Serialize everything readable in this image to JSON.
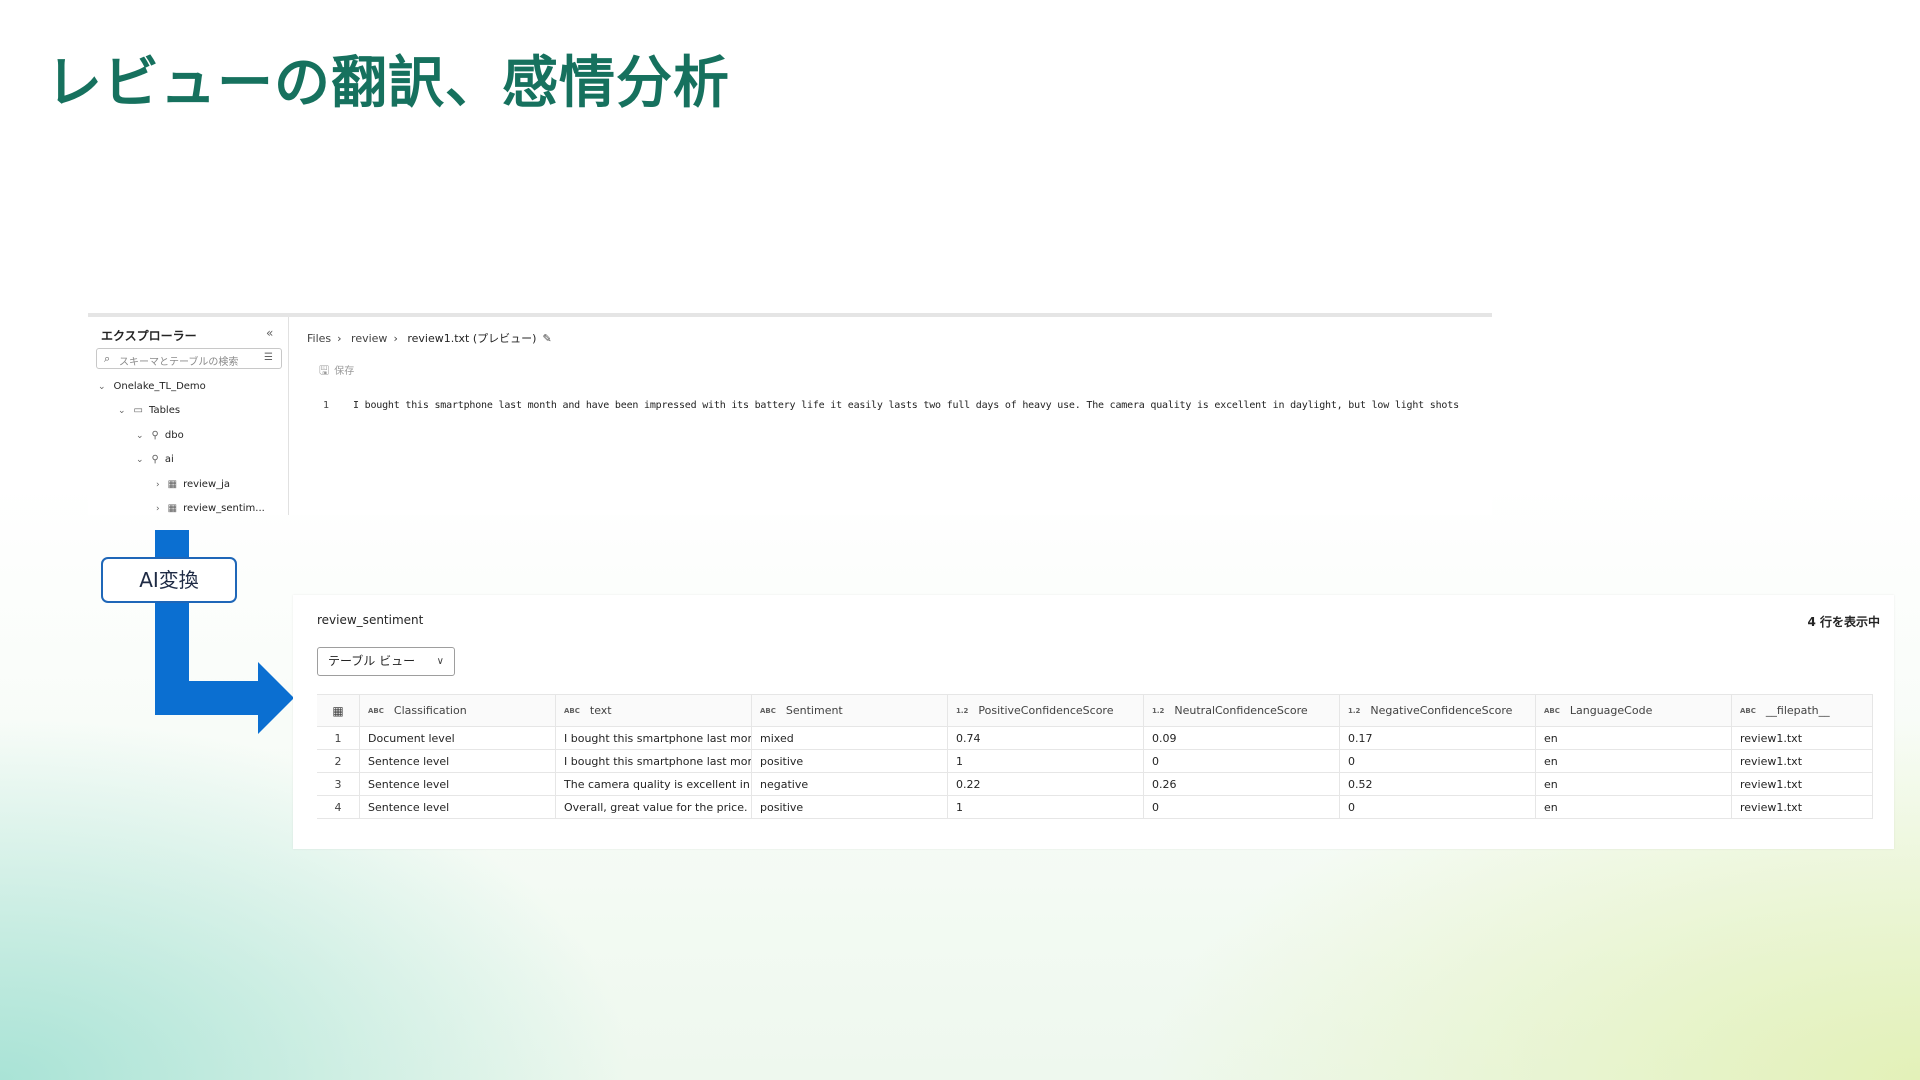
{
  "slide": {
    "title": "レビューの翻訳、感情分析"
  },
  "explorer": {
    "title": "エクスプローラー",
    "search_placeholder": "スキーマとテーブルの検索",
    "tree": [
      {
        "label": "Onelake_TL_Demo"
      },
      {
        "label": "Tables"
      },
      {
        "label": "dbo"
      },
      {
        "label": "ai"
      },
      {
        "label": "review_ja"
      },
      {
        "label": "review_sentim..."
      }
    ]
  },
  "viewer": {
    "breadcrumb": [
      "Files",
      "review",
      "review1.txt (プレビュー)"
    ],
    "save_label": "保存",
    "line_number": "1",
    "line_text": "I bought this smartphone last month and have been impressed with its battery life it easily lasts two full days of heavy use. The camera quality is excellent in daylight, but low light shots"
  },
  "transform_label": "AI変換",
  "result": {
    "table_name": "review_sentiment",
    "row_count": "4 行を表示中",
    "view_select": "テーブル ビュー",
    "columns": [
      {
        "type": "ABC",
        "name": "Classification"
      },
      {
        "type": "ABC",
        "name": "text"
      },
      {
        "type": "ABC",
        "name": "Sentiment"
      },
      {
        "type": "1.2",
        "name": "PositiveConfidenceScore"
      },
      {
        "type": "1.2",
        "name": "NeutralConfidenceScore"
      },
      {
        "type": "1.2",
        "name": "NegativeConfidenceScore"
      },
      {
        "type": "ABC",
        "name": "LanguageCode"
      },
      {
        "type": "ABC",
        "name": "__filepath__"
      }
    ],
    "rows": [
      {
        "idx": "1",
        "cells": [
          "Document level",
          "I bought this smartphone last mon...",
          "mixed",
          "0.74",
          "0.09",
          "0.17",
          "en",
          "review1.txt"
        ]
      },
      {
        "idx": "2",
        "cells": [
          "Sentence level",
          "I bought this smartphone last mon...",
          "positive",
          "1",
          "0",
          "0",
          "en",
          "review1.txt"
        ]
      },
      {
        "idx": "3",
        "cells": [
          "Sentence level",
          "The camera quality is excellent in d...",
          "negative",
          "0.22",
          "0.26",
          "0.52",
          "en",
          "review1.txt"
        ]
      },
      {
        "idx": "4",
        "cells": [
          "Sentence level",
          "Overall, great value for the price.",
          "positive",
          "1",
          "0",
          "0",
          "en",
          "review1.txt"
        ]
      }
    ]
  },
  "colors": {
    "title": "#16715e",
    "arrow": "#0b6fd1",
    "badge_border": "#1f67b8"
  }
}
